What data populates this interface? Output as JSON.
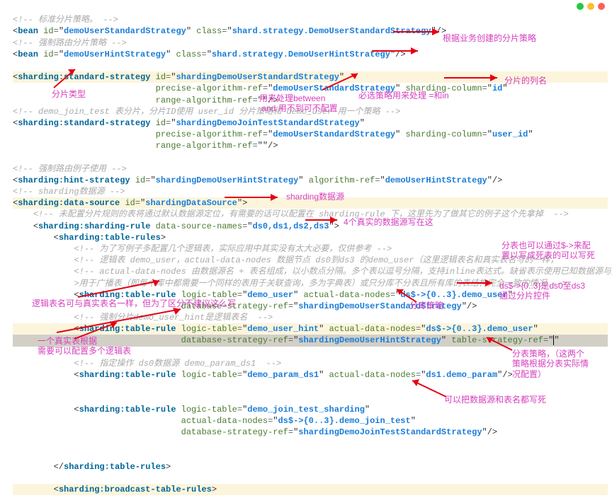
{
  "traffic": {
    "names": [
      "close",
      "minimize",
      "maximize"
    ]
  },
  "code": {
    "c1": "<!-- 标准分片策略。 -->",
    "bean1_id": "demoUserStandardStrategy",
    "bean1_class": "shard.strategy.DemoUserStandardStrategy",
    "c2": "<!-- 强制路由分片策略 -->",
    "bean2_id": "demoUserHintStrategy",
    "bean2_class": "shard.strategy.DemoUserHintStrategy",
    "ss1_id": "shardingDemoUserStandardStrategy",
    "ss1_par": "demoUserStandardStrategy",
    "ss1_col": "id",
    "ss1_rar": "",
    "c3": "<!-- demo_join_test 表分片，分片ID使用 user_id 分片策略和 demo_user 用一个策略 -->",
    "ss2_id": "shardingDemoJoinTestStandardStrategy",
    "ss2_par": "demoUserStandardStrategy",
    "ss2_col": "user_id",
    "ss2_rar": "",
    "c4": "<!-- 强制路由例子使用 -->",
    "hs_id": "shardingDemoUserHintStrategy",
    "hs_algo": "demoUserHintStrategy",
    "c5": "<!-- sharding数据源 -->",
    "ds_id": "shardingDataSource",
    "c6": "<!-- 未配置分片规则的表将通过默认数据源定位，有需要的话可以配置在 sharding-rule 下，这里先为了做其它的例子这个先拿掉  -->",
    "rule_dsn": "ds0,ds1,ds2,ds3",
    "c7": "<!-- 为了写例子多配置几个逻辑表，实际应用中其实没有太大必要，仅供参考 -->",
    "c8_a": "<!-- 逻辑表 demo_user，actual-data-nodes 数据节点 ds0到ds3 的demo_user（这里逻辑表名和真实表名写的一样，",
    "c8_b": "置以写成死表的可以写死",
    "c9": "<!-- actual-data-nodes 由数据源名 + 表名组成，以小数点分隔。多个表以逗号分隔，支持inline表达式。缺省表示使用已知数据源与逻辑表名称生成数据",
    "c10": ">用于广播表（即每个库中都需要一个同样的表用于关联查询，多为字典表）或只分库不分表且所有库的表结构完全一致的情况 -->",
    "tr1_lt": "demo_user",
    "tr1_adn": "ds$->{0..3}.demo_user",
    "tr1_dsr": "shardingDemoUserStandardStrategy",
    "c11": "<!-- 强制分片demo_user_hint是逻辑表名  -->",
    "tr2_lt": "demo_user_hint",
    "tr2_adn": "ds$->{0..3}.demo_user",
    "tr2_dsr": "shardingDemoUserHintStrategy",
    "tr2_tsr": "",
    "c12": "<!-- 指定操作 ds0数据源 demo_param_ds1  -->",
    "tr3_lt": "demo_param_ds1",
    "tr3_adn": "ds1.demo_param",
    "tr4_lt": "demo_join_test_sharding",
    "tr4_adn": "ds$->{0..3}.demo_join_test",
    "tr4_dsr": "shardingDemoJoinTestStandardStrategy"
  },
  "ann": {
    "a1": "根据业务创建的分片策略",
    "a2": "分片的列名",
    "a3": "分片类型",
    "a4": "用来处理between\n and 用不到可不配置",
    "a5": "必选策略用来处理 =和in",
    "a6": "sharding数据源",
    "a7": "4个真实的数据源写在这",
    "a8": "分表也可以通过$->来配\n置以写成死表的可以写死",
    "a9": "ds$->{0..3}是ds0至ds3\n     通过分片控件",
    "a10": "逻辑表名可与真实表名一样，但为了区分不建议这么写",
    "a11": "一个真实表根据\n需要可以配置多个逻辑表",
    "a12": "分库策略",
    "a13": "分表策略，（这两个\n策略根据分表实际情\n况配置）",
    "a14": "可以把数据源和表名都写死"
  }
}
